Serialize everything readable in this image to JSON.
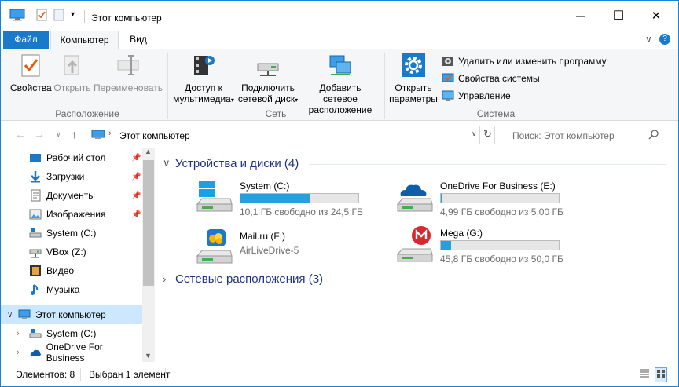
{
  "window": {
    "title": "Этот компьютер",
    "minimize_glyph": "—",
    "maximize_glyph": "☐",
    "close_glyph": "✕"
  },
  "ribbon_tabs": {
    "file": "Файл",
    "computer": "Компьютер",
    "view": "Вид"
  },
  "ribbon": {
    "groups": {
      "location": "Расположение",
      "network": "Сеть",
      "system": "Система"
    },
    "buttons": {
      "properties": "Свойства",
      "open": "Открыть",
      "rename": "Переименовать",
      "media_access_1": "Доступ к",
      "media_access_2": "мультимедиа",
      "map_drive_1": "Подключить",
      "map_drive_2": "сетевой диск",
      "add_location_1": "Добавить сетевое",
      "add_location_2": "расположение",
      "open_settings_1": "Открыть",
      "open_settings_2": "параметры"
    },
    "system_items": [
      "Удалить или изменить программу",
      "Свойства системы",
      "Управление"
    ],
    "accent": "#1979ca"
  },
  "address": {
    "path": "Этот компьютер",
    "search_placeholder": "Поиск: Этот компьютер"
  },
  "nav": {
    "quick_access": [
      {
        "label": "Рабочий стол",
        "pinned": true,
        "icon": "desktop-icon"
      },
      {
        "label": "Загрузки",
        "pinned": true,
        "icon": "download-icon"
      },
      {
        "label": "Документы",
        "pinned": true,
        "icon": "documents-icon"
      },
      {
        "label": "Изображения",
        "pinned": true,
        "icon": "pictures-icon"
      },
      {
        "label": "System (C:)",
        "pinned": false,
        "icon": "drive-icon"
      },
      {
        "label": "VBox (Z:)",
        "pinned": false,
        "icon": "network-drive-icon"
      },
      {
        "label": "Видео",
        "pinned": false,
        "icon": "video-icon"
      },
      {
        "label": "Музыка",
        "pinned": false,
        "icon": "music-icon"
      }
    ],
    "this_pc": "Этот компьютер",
    "children": [
      "System (C:)",
      "OneDrive For Business"
    ]
  },
  "content": {
    "devices_header": "Устройства и диски (4)",
    "network_header": "Сетевые расположения (3)",
    "drives": [
      {
        "name": "System (C:)",
        "info": "10,1 ГБ свободно из 24,5 ГБ",
        "used_fraction": 0.59,
        "icon": "windows-drive-icon"
      },
      {
        "name": "OneDrive For Business (E:)",
        "info": "4,99 ГБ свободно из 5,00 ГБ",
        "used_fraction": 0.002,
        "icon": "onedrive-drive-icon"
      },
      {
        "name": "Mail.ru (F:)",
        "info": "AirLiveDrive-5",
        "icon": "mailru-drive-icon"
      },
      {
        "name": "Mega (G:)",
        "info": "45,8 ГБ свободно из 50,0 ГБ",
        "used_fraction": 0.084,
        "icon": "mega-drive-icon"
      }
    ]
  },
  "status": {
    "items_count": "Элементов: 8",
    "selected": "Выбран 1 элемент"
  }
}
